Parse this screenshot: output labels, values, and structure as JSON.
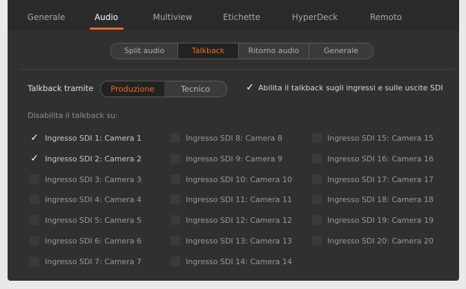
{
  "tabs": [
    {
      "label": "Generale"
    },
    {
      "label": "Audio"
    },
    {
      "label": "Multiview"
    },
    {
      "label": "Etichette"
    },
    {
      "label": "HyperDeck"
    },
    {
      "label": "Remoto"
    }
  ],
  "active_tab": "Audio",
  "subtabs": [
    {
      "label": "Split audio"
    },
    {
      "label": "Talkback"
    },
    {
      "label": "Ritorno audio"
    },
    {
      "label": "Generale"
    }
  ],
  "active_subtab": "Talkback",
  "talkback": {
    "label": "Talkback tramite",
    "options": [
      "Produzione",
      "Tecnico"
    ],
    "selected": "Produzione",
    "enable_label": "Abilita il talkback sugli ingressi e sulle uscite SDI",
    "enable_checked": true,
    "disable_label": "Disabilita il talkback su:"
  },
  "inputs": [
    {
      "label": "Ingresso SDI 1: Camera 1",
      "checked": true
    },
    {
      "label": "Ingresso SDI 2: Camera 2",
      "checked": true
    },
    {
      "label": "Ingresso SDI 3: Camera 3",
      "checked": false
    },
    {
      "label": "Ingresso SDI 4: Camera 4",
      "checked": false
    },
    {
      "label": "Ingresso SDI 5: Camera 5",
      "checked": false
    },
    {
      "label": "Ingresso SDI 6: Camera 6",
      "checked": false
    },
    {
      "label": "Ingresso SDI 7: Camera 7",
      "checked": false
    },
    {
      "label": "Ingresso SDI 8: Camera 8",
      "checked": false
    },
    {
      "label": "Ingresso SDI 9: Camera 9",
      "checked": false
    },
    {
      "label": "Ingresso SDI 10: Camera 10",
      "checked": false
    },
    {
      "label": "Ingresso SDI 11: Camera 11",
      "checked": false
    },
    {
      "label": "Ingresso SDI 12: Camera 12",
      "checked": false
    },
    {
      "label": "Ingresso SDI 13: Camera 13",
      "checked": false
    },
    {
      "label": "Ingresso SDI 14: Camera 14",
      "checked": false
    },
    {
      "label": "Ingresso SDI 15: Camera 15",
      "checked": false
    },
    {
      "label": "Ingresso SDI 16: Camera 16",
      "checked": false
    },
    {
      "label": "Ingresso SDI 17: Camera 17",
      "checked": false
    },
    {
      "label": "Ingresso SDI 18: Camera 18",
      "checked": false
    },
    {
      "label": "Ingresso SDI 19: Camera 19",
      "checked": false
    },
    {
      "label": "Ingresso SDI 20: Camera 20",
      "checked": false
    }
  ],
  "colors": {
    "accent": "#f26a21",
    "panel": "#303030",
    "tabbar": "#2a2a2a"
  },
  "icons": {
    "check": "checkmark-icon"
  }
}
